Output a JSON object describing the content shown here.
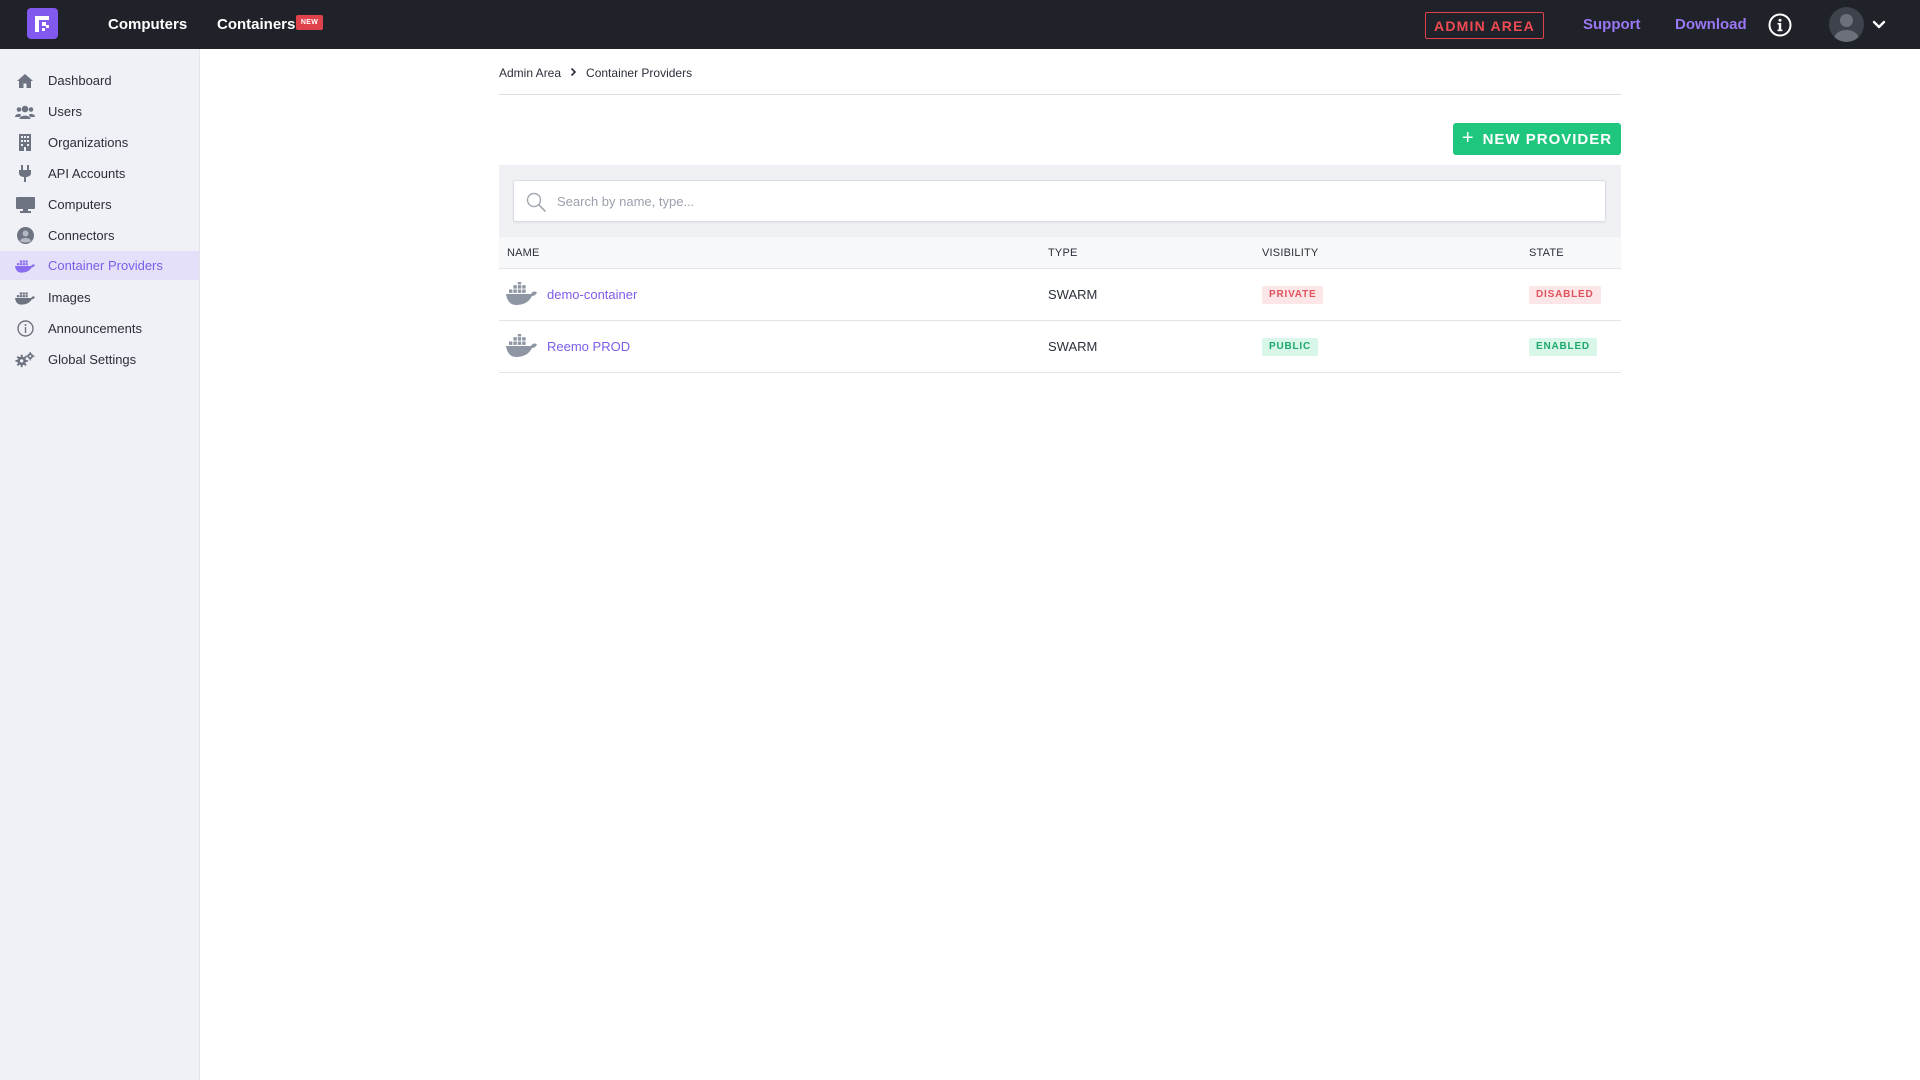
{
  "topbar": {
    "nav": {
      "computers": "Computers",
      "containers": "Containers",
      "containers_badge": "NEW"
    },
    "admin_area": "ADMIN AREA",
    "support": "Support",
    "download": "Download"
  },
  "sidebar": {
    "items": [
      {
        "label": "Dashboard",
        "icon": "home-icon"
      },
      {
        "label": "Users",
        "icon": "users-icon"
      },
      {
        "label": "Organizations",
        "icon": "building-icon"
      },
      {
        "label": "API Accounts",
        "icon": "plug-icon"
      },
      {
        "label": "Computers",
        "icon": "monitor-icon"
      },
      {
        "label": "Connectors",
        "icon": "user-circle-icon"
      },
      {
        "label": "Container Providers",
        "icon": "docker-icon",
        "active": true
      },
      {
        "label": "Images",
        "icon": "docker-icon"
      },
      {
        "label": "Announcements",
        "icon": "info-icon"
      },
      {
        "label": "Global Settings",
        "icon": "gears-icon"
      }
    ]
  },
  "breadcrumb": {
    "root": "Admin Area",
    "current": "Container Providers"
  },
  "actions": {
    "new_provider": "NEW PROVIDER"
  },
  "search": {
    "placeholder": "Search by name, type..."
  },
  "table": {
    "columns": {
      "name": "NAME",
      "type": "TYPE",
      "visibility": "VISIBILITY",
      "state": "STATE"
    },
    "rows": [
      {
        "name": "demo-container",
        "type": "SWARM",
        "visibility": "PRIVATE",
        "state": "DISABLED"
      },
      {
        "name": "Reemo PROD",
        "type": "SWARM",
        "visibility": "PUBLIC",
        "state": "ENABLED"
      }
    ]
  },
  "colors": {
    "accent": "#7e5ce9",
    "topbar": "#1f2228",
    "success": "#1fc77e",
    "danger": "#e0424c"
  }
}
